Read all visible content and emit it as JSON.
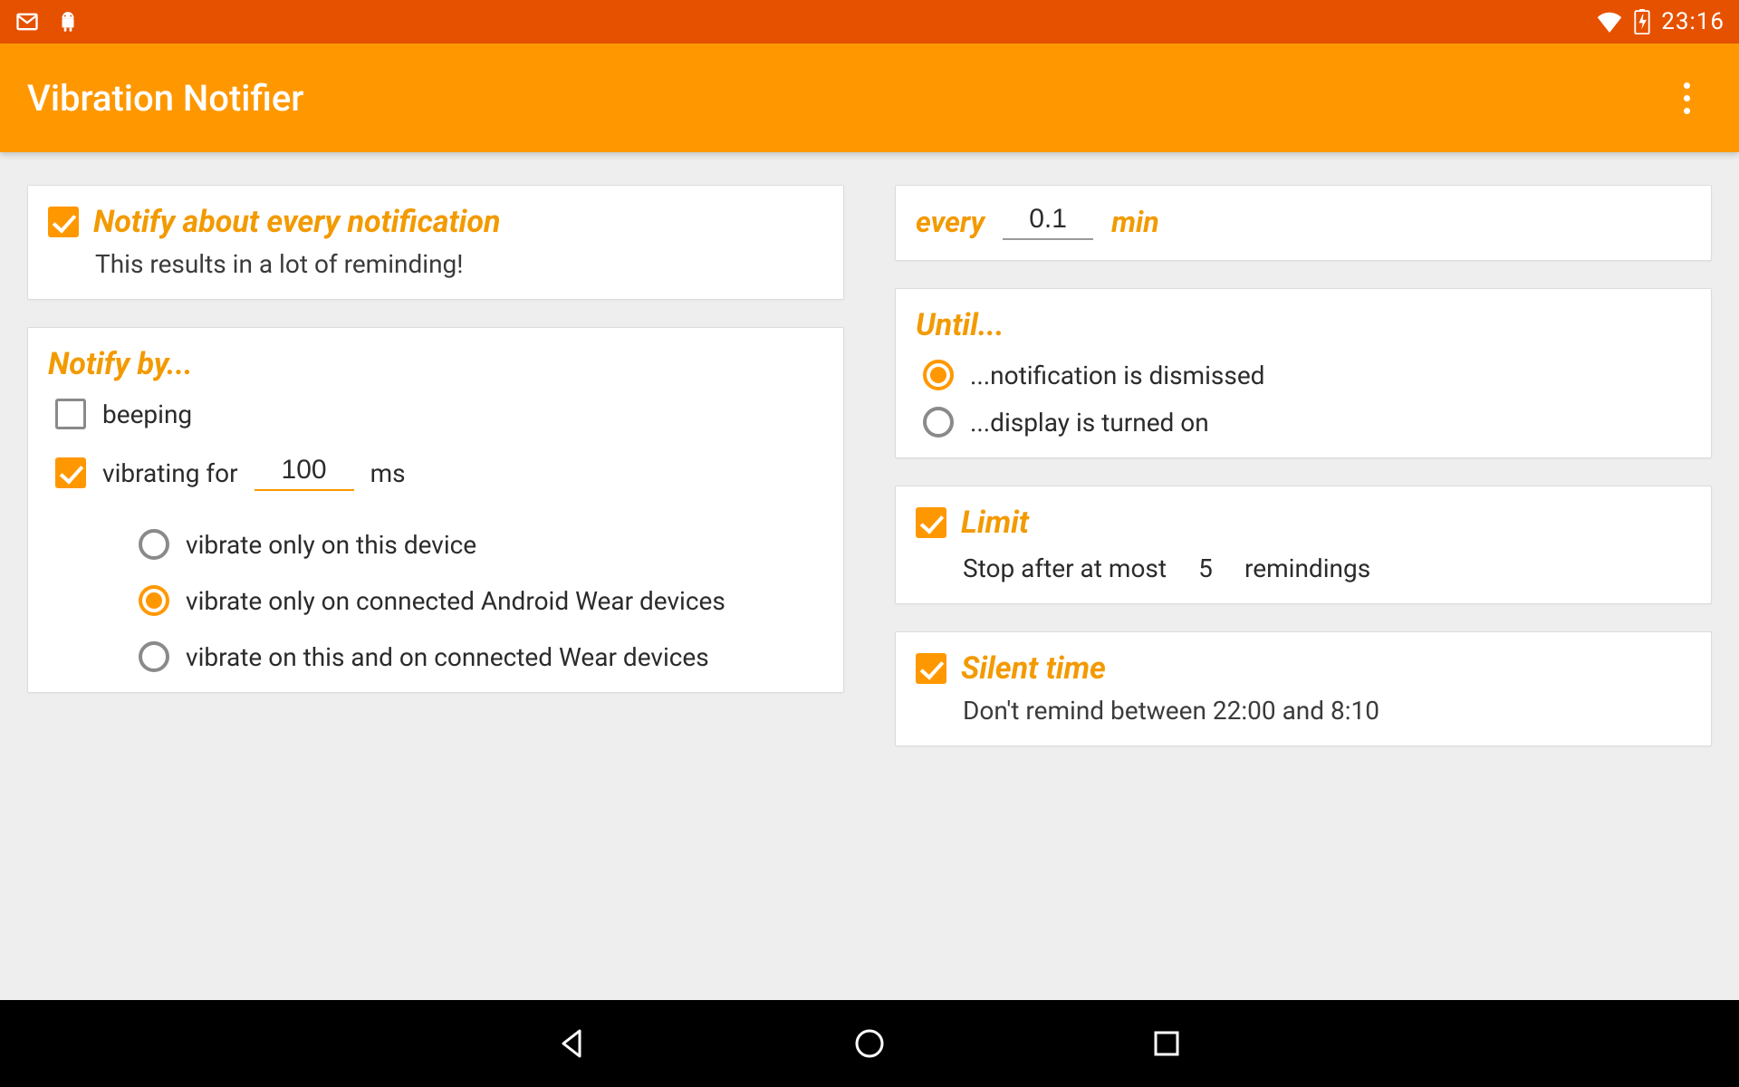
{
  "status": {
    "time": "23:16"
  },
  "app": {
    "title": "Vibration Notifier"
  },
  "notify_every": {
    "title": "Notify about every notification",
    "subtitle": "This results in a lot of reminding!",
    "checked": true
  },
  "notify_by": {
    "title": "Notify by...",
    "beeping": {
      "label": "beeping",
      "checked": false
    },
    "vibrating": {
      "checked": true,
      "prefix": "vibrating for",
      "value": "100",
      "suffix": "ms",
      "options": [
        "vibrate only on this device",
        "vibrate only on connected Android Wear devices",
        "vibrate on this and on connected Wear devices"
      ],
      "selected": 1
    }
  },
  "interval": {
    "prefix": "every",
    "value": "0.1",
    "suffix": "min"
  },
  "until": {
    "title": "Until...",
    "options": [
      "...notification is dismissed",
      "...display is turned on"
    ],
    "selected": 0
  },
  "limit": {
    "checked": true,
    "title": "Limit",
    "prefix": "Stop after at most",
    "value": "5",
    "suffix": "remindings"
  },
  "silent": {
    "checked": true,
    "title": "Silent time",
    "text": "Don't remind between 22:00 and 8:10"
  }
}
